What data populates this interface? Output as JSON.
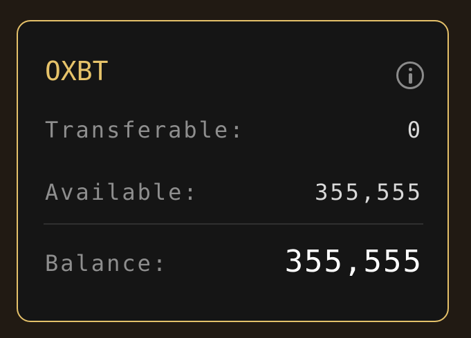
{
  "card": {
    "token": "OXBT",
    "info_icon": "info-circle-icon",
    "rows": [
      {
        "label": "Transferable:",
        "value": "0"
      },
      {
        "label": "Available:",
        "value": "355,555"
      },
      {
        "label": "Balance:",
        "value": "355,555"
      }
    ]
  },
  "colors": {
    "background": "#211a13",
    "card": "#151515",
    "accent": "#e5c16a",
    "label": "#8e8e8e",
    "value": "#d9d9d9",
    "balance": "#ffffff"
  }
}
